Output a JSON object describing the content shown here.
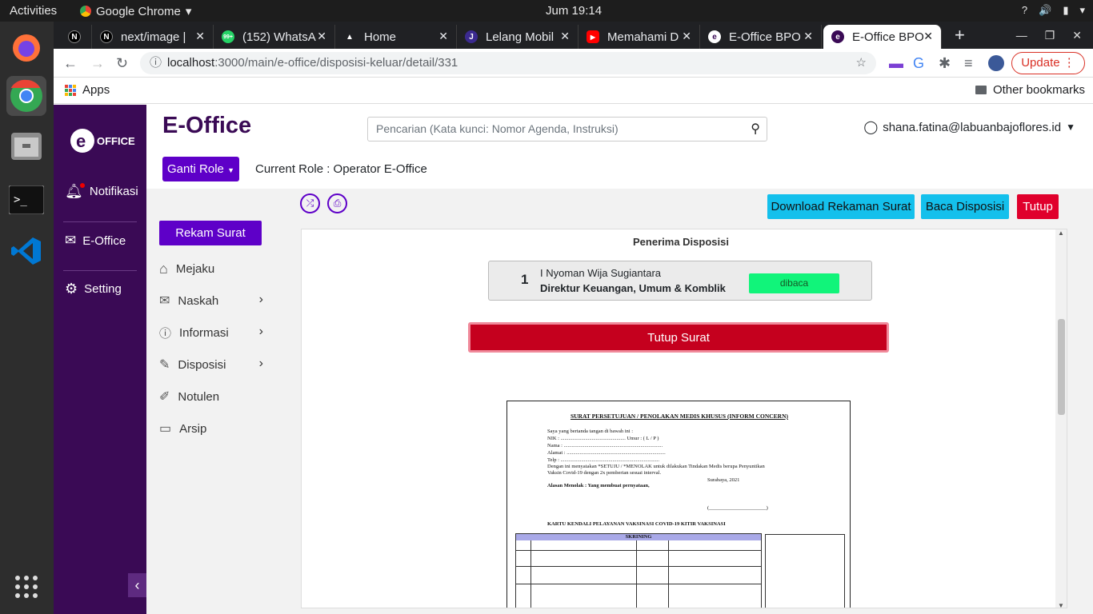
{
  "os": {
    "activities": "Activities",
    "app_name": "Google Chrome",
    "clock": "Jum 19:14"
  },
  "browser": {
    "tabs": [
      {
        "label": "",
        "favicon": "N",
        "fav_color": "#000000"
      },
      {
        "label": "next/image |",
        "favicon": "N",
        "fav_color": "#000000"
      },
      {
        "label": "(152) WhatsA",
        "favicon": "99+",
        "fav_color": "#25d366"
      },
      {
        "label": "Home",
        "favicon": "▲",
        "fav_color": "#202124"
      },
      {
        "label": "Lelang Mobil",
        "favicon": "J",
        "fav_color": "#3b2a8f"
      },
      {
        "label": "Memahami D",
        "favicon": "▶",
        "fav_color": "#ff0000"
      },
      {
        "label": "E-Office BPO",
        "favicon": "e",
        "fav_color": "#3a0a55"
      },
      {
        "label": "E-Office BPO",
        "favicon": "e",
        "fav_color": "#3a0a55"
      }
    ],
    "url_host": "localhost",
    "url_path": ":3000/main/e-office/disposisi-keluar/detail/331",
    "update_label": "Update",
    "bookmarks": {
      "apps": "Apps",
      "other": "Other bookmarks"
    }
  },
  "sidebar": {
    "logo_text": "OFFICE",
    "items": [
      {
        "label": "Notifikasi",
        "icon": "bell-icon"
      },
      {
        "label": "E-Office",
        "icon": "mail-icon"
      },
      {
        "label": "Setting",
        "icon": "gear-icon"
      }
    ]
  },
  "header": {
    "title": "E-Office",
    "search_placeholder": "Pencarian (Kata kunci: Nomor Agenda, Instruksi)",
    "user_email": "shana.fatina@labuanbajoflores.id",
    "role_button": "Ganti Role",
    "current_role": "Current Role : Operator E-Office"
  },
  "menu": {
    "rekam": "Rekam Surat",
    "items": [
      {
        "label": "Mejaku",
        "icon": "home-icon",
        "chevron": false
      },
      {
        "label": "Naskah",
        "icon": "envelope-icon",
        "chevron": true
      },
      {
        "label": "Informasi",
        "icon": "info-icon",
        "chevron": true
      },
      {
        "label": "Disposisi",
        "icon": "note-icon",
        "chevron": true
      },
      {
        "label": "Notulen",
        "icon": "pen-icon",
        "chevron": false
      },
      {
        "label": "Arsip",
        "icon": "archive-icon",
        "chevron": false
      }
    ]
  },
  "actions": {
    "download": "Download Rekaman Surat",
    "baca": "Baca Disposisi",
    "tutup": "Tutup"
  },
  "disposisi": {
    "heading": "Penerima Disposisi",
    "recipient": {
      "number": "1",
      "name": "I Nyoman Wija Sugiantara",
      "position": "Direktur Keuangan, Umum & Komblik",
      "status": "dibaca"
    },
    "close_button": "Tutup Surat"
  },
  "document": {
    "title": "SURAT PERSETUJUAN / PENOLAKAN MEDIS KHUSUS (INFORM CONCERN)",
    "lines": [
      "Saya yang bertanda tangan di bawah ini :",
      "NIK          : ..................................................          Umur :                    ( L / P )",
      "Nama         : ............................................................................",
      "Alamat       : ............................................................................",
      "Telp         : ............................................................................",
      "Dengan ini menyatakan *SETUJU / *MENOLAK untuk dilakukan Tindakan Medis berupa Penyuntikan",
      "Vaksin Covid-19 dengan 2x pemberian sesuai interval.",
      "Surabaya,                 2021",
      "Alasan Menolak :                                   Yang membuat pernyataan,",
      "(______________________)",
      "KARTU KENDALI PELAYANAN VAKSINASI COVID-19                           KITIR VAKSINASI",
      "SKRINING"
    ]
  }
}
